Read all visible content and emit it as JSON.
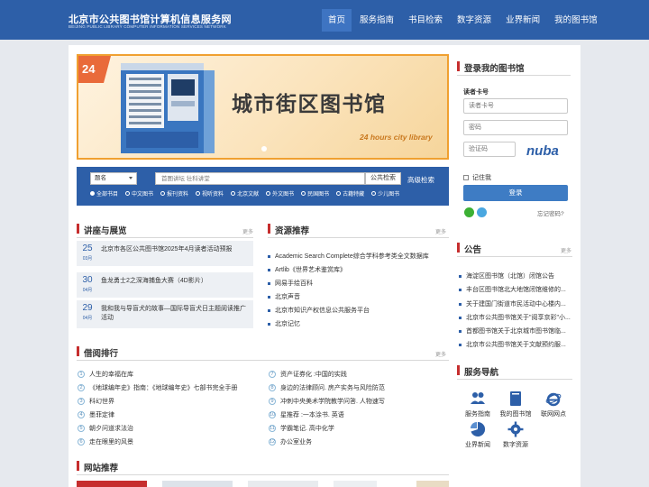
{
  "header": {
    "logo_cn": "北京市公共图书馆计算机信息服务网",
    "logo_en": "BEIJING PUBLIC LIBRARY COMPUTER INFORMATION SERVICES NETWORK",
    "nav": [
      "首页",
      "服务指南",
      "书目检索",
      "数字资源",
      "业界新闻",
      "我的图书馆"
    ],
    "active_index": 0
  },
  "banner": {
    "title": "城市街区图书馆",
    "subtitle": "24 hours city library",
    "badge": "24"
  },
  "search": {
    "select_value": "题名",
    "placeholder": "首图讲坛 壮科讲堂",
    "button": "公共检索",
    "advanced": "高级检索",
    "options": [
      "全部书目",
      "中文图书",
      "报刊资料",
      "视听资料",
      "北京文献",
      "外文图书",
      "民国图书",
      "古籍特藏",
      "少儿图书"
    ],
    "selected_option": "全部书目"
  },
  "lectures": {
    "title": "讲座与展览",
    "more": "更多",
    "items": [
      {
        "day": "25",
        "month": "03月",
        "text": "北京市各区公共图书馆2025年4月读者活动预报"
      },
      {
        "day": "30",
        "month": "04月",
        "text": "鱼龙勇士2之深海捕鱼大赛（4D影片）"
      },
      {
        "day": "29",
        "month": "04月",
        "text": "我和我与导盲犬的故事—国际导盲犬日主题阅读推广活动"
      }
    ]
  },
  "resources": {
    "title": "资源推荐",
    "more": "更多",
    "items": [
      "Academic Search Complete综合学科参考类全文数据库",
      "Artlib《世界艺术鉴赏库》",
      "网易手绘百科",
      "北京声音",
      "北京市知识产权信息公共服务平台",
      "北京记忆"
    ]
  },
  "ranking": {
    "title": "借阅排行",
    "more": "更多",
    "left": [
      {
        "num": "1",
        "text": "人生的幸福在库"
      },
      {
        "num": "2",
        "text": "《地球编年史》指南：《地球编年史》七部书完全手册"
      },
      {
        "num": "3",
        "text": "科幻世界"
      },
      {
        "num": "4",
        "text": "墨菲定律"
      },
      {
        "num": "5",
        "text": "朝夕问道求法治"
      },
      {
        "num": "6",
        "text": "走在眼里的风景"
      }
    ],
    "right": [
      {
        "num": "7",
        "text": "资产证券化 :中国的实践"
      },
      {
        "num": "8",
        "text": "身边的法律顾问. 房产实务与风险防范"
      },
      {
        "num": "9",
        "text": "冲刺中央美术学院教学问答. 人物速写"
      },
      {
        "num": "10",
        "text": "星推荐 :一本涂书. 英语"
      },
      {
        "num": "11",
        "text": "学霸笔记. 高中化学"
      },
      {
        "num": "12",
        "text": "办公室业务"
      }
    ]
  },
  "sites": {
    "title": "网站推荐"
  },
  "login": {
    "title": "登录我的图书馆",
    "card_label": "读者卡号",
    "card_placeholder": "读者卡号",
    "password_placeholder": "密码",
    "captcha_placeholder": "验证码",
    "captcha_text": "nuba",
    "remember": "记住我",
    "button": "登录",
    "forgot": "忘记密码?"
  },
  "notice": {
    "title": "公告",
    "more": "更多",
    "items": [
      "海淀区图书馆（北馆）闭馆公告",
      "丰台区图书馆北大地馆闭馆维修的...",
      "关于建国门街道市民活动中心楼内...",
      "北京市公共图书馆关于\"阅享京彩\"小...",
      "首都图书馆关于北京城市图书馆临...",
      "北京市公共图书馆关于文献预约服..."
    ]
  },
  "services": {
    "title": "服务导航",
    "items": [
      {
        "label": "服务指南",
        "icon": "people-icon"
      },
      {
        "label": "我的图书馆",
        "icon": "book-icon"
      },
      {
        "label": "联网网点",
        "icon": "ie-icon"
      },
      {
        "label": "业界新闻",
        "icon": "pie-chart-icon"
      },
      {
        "label": "数字资源",
        "icon": "gear-icon"
      }
    ]
  },
  "colors": {
    "header_bg": "#2d5fa8",
    "accent_red": "#c62e2e",
    "login_button": "#3e7cc4"
  }
}
